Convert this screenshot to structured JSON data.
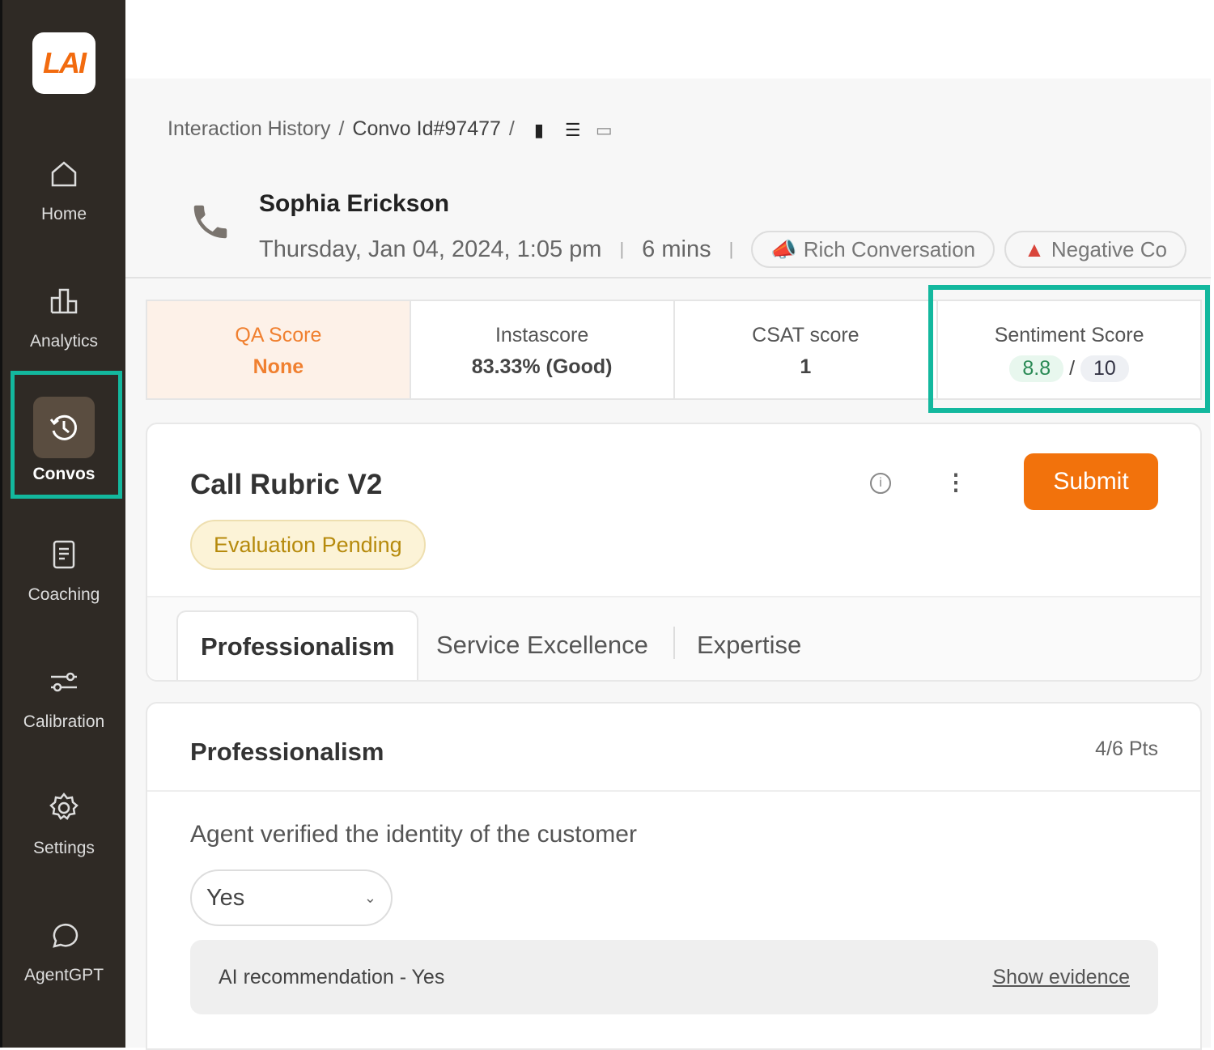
{
  "sidebar": {
    "logo": "LAI",
    "items": [
      {
        "label": "Home",
        "icon": "home-icon"
      },
      {
        "label": "Analytics",
        "icon": "bar-chart-icon"
      },
      {
        "label": "Convos",
        "icon": "history-icon",
        "active": true
      },
      {
        "label": "Coaching",
        "icon": "document-icon"
      },
      {
        "label": "Calibration",
        "icon": "sliders-icon"
      },
      {
        "label": "Settings",
        "icon": "gear-icon"
      },
      {
        "label": "AgentGPT",
        "icon": "chat-icon"
      }
    ]
  },
  "breadcrumb": {
    "root": "Interaction History",
    "current": "Convo Id#97477",
    "sep": "/"
  },
  "contact": {
    "name": "Sophia Erickson",
    "datetime": "Thursday, Jan 04, 2024, 1:05 pm",
    "duration": "6 mins",
    "tags": [
      "Rich Conversation",
      "Negative Co"
    ]
  },
  "scores": {
    "qa_label": "QA Score",
    "qa_value": "None",
    "insta_label": "Instascore",
    "insta_value": "83.33% (Good)",
    "csat_label": "CSAT score",
    "csat_value": "1",
    "sent_label": "Sentiment Score",
    "sent_value": "8.8",
    "sent_sep": "/",
    "sent_max": "10"
  },
  "rubric": {
    "title": "Call Rubric V2",
    "status": "Evaluation Pending",
    "submit": "Submit",
    "tabs": [
      "Professionalism",
      "Service Excellence",
      "Expertise"
    ]
  },
  "section": {
    "title": "Professionalism",
    "points": "4/6 Pts",
    "question": "Agent verified the identity of the customer",
    "answer": "Yes",
    "ai_rec": "AI recommendation - Yes",
    "evidence": "Show evidence"
  },
  "colors": {
    "accent": "#f2720c",
    "highlight": "#13b89e",
    "sidebar": "#2f2a25"
  }
}
